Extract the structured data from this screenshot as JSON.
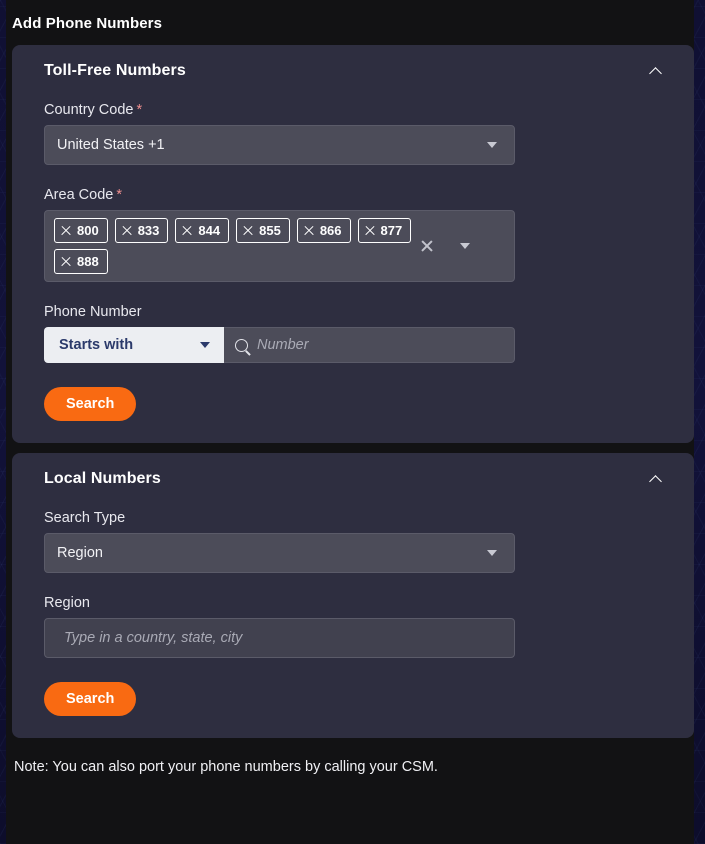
{
  "page": {
    "title": "Add Phone Numbers",
    "note": "Note: You can also port your phone numbers by calling your CSM.",
    "accent_color": "#f96a12",
    "card_color": "#2e2e40",
    "background_color": "#121214",
    "required_marker": "*"
  },
  "toll_free": {
    "title": "Toll-Free Numbers",
    "collapse_icon": "chevron-up-icon",
    "country_code": {
      "label": "Country Code",
      "required": true,
      "value": "United States +1",
      "dropdown_icon": "caret-down-icon"
    },
    "area_code": {
      "label": "Area Code",
      "required": true,
      "chips": [
        "800",
        "833",
        "844",
        "855",
        "866",
        "877",
        "888"
      ],
      "chip_remove_icon": "close-icon",
      "clear_icon": "clear-all-icon",
      "dropdown_icon": "caret-down-icon"
    },
    "phone_number": {
      "label": "Phone Number",
      "match_mode": "Starts with",
      "match_dropdown_icon": "caret-down-icon",
      "search_icon": "search-icon",
      "placeholder": "Number",
      "value": ""
    },
    "search_label": "Search"
  },
  "local": {
    "title": "Local Numbers",
    "collapse_icon": "chevron-up-icon",
    "search_type": {
      "label": "Search Type",
      "value": "Region",
      "dropdown_icon": "caret-down-icon"
    },
    "region": {
      "label": "Region",
      "placeholder": "Type in a country, state, city",
      "value": ""
    },
    "search_label": "Search"
  }
}
